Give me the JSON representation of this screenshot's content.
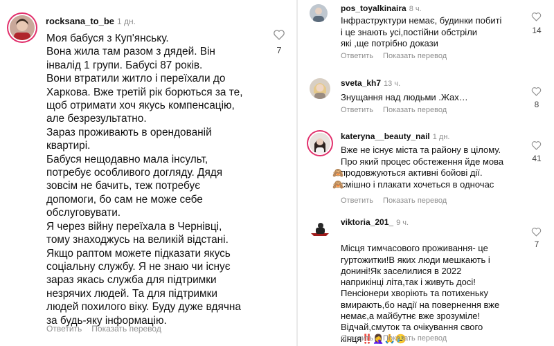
{
  "actions": {
    "reply": "Ответить",
    "translate": "Показать перевод"
  },
  "left_comment": {
    "username": "rocksana_to_be",
    "time": "1 дн.",
    "text": "Моя бабуся з Куп'янську.\nВона жила там разом з дядей. Він\nінвалід 1 групи. Бабусі 87 років.\nВони втратили житло і переїхали до\nХаркова. Вже третій рік борються за те,\nщоб отримати хоч якусь компенсацію,\nале безрезультатно.\nЗараз проживають в орендованій\nквартирі.\nБабуся нещодавно мала інсульт,\nпотребує особливого догляду. Дядя\nзовсім не бачить, теж потребує\nдопомоги, бо сам не може себе\nобслуговувати.\nЯ через війну переїхала в Чернівці,\nтому знаходжусь на великій відстані.\nЯкщо раптом можете підказати якусь\nсоціальну службу. Я не знаю чи існує\nзараз якась служба для підтримки\nнезрячих людей. Та для підтримки\nлюдей похилого віку. Буду дуже вдячна\nза будь-яку інформацію.",
    "likes": "7"
  },
  "comments": [
    {
      "username": "pos_toyalkinaira",
      "time": "8 ч.",
      "text": "Інфраструктури немає, будинки побиті\nі це знають усі,постійни обстріли\nякі ,ще потрібно докази",
      "likes": "14"
    },
    {
      "username": "sveta_kh7",
      "time": "13 ч.",
      "text": "Знущання над людьми .Жах…",
      "likes": "8"
    },
    {
      "username": "kateryna__beauty_nail",
      "time": "1 дн.",
      "text_lines": [
        "Вже не існує міста та району в цілому.",
        "Про який процес обстеження йде мова",
        "продовжуються активні бойові дії.",
        "смішно і плакати хочеться в одночас"
      ],
      "emoji_monkey": "🙈",
      "likes": "41"
    },
    {
      "username": "viktoria_201_",
      "time": "9 ч.",
      "text": "Місця тимчасового проживання- це\nгуртожитки!В яких люди мешкають і\nдонині!Як заселилися в 2022\nнаприкінці літа,так і живуть досі!\nПенсіонери хворіють та потихеньку\nвмирають,бо надії на повернення вже\nнемає,а майбутнє вже зрозуміле!\nВідчай,смуток та очікування свого\nкінця",
      "end_emojis": "‼️🤦‍♀️🙏😢",
      "likes": "7"
    }
  ]
}
